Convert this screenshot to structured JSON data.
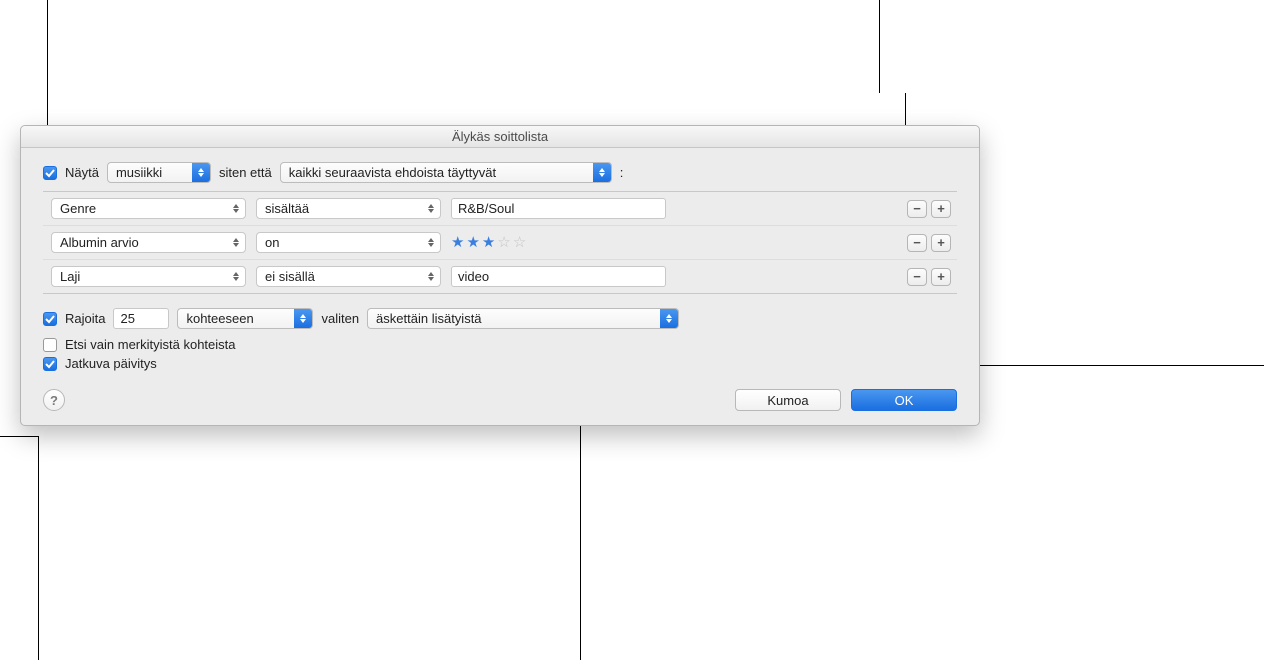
{
  "title": "Älykäs soittolista",
  "match": {
    "show_label": "Näytä",
    "media": "musiikki",
    "so_that": "siten että",
    "condition": "kaikki seuraavista ehdoista täyttyvät",
    "colon": ":"
  },
  "rules": [
    {
      "field": "Genre",
      "op": "sisältää",
      "value": "R&B/Soul",
      "type": "text"
    },
    {
      "field": "Albumin arvio",
      "op": "on",
      "stars": 3,
      "type": "stars"
    },
    {
      "field": "Laji",
      "op": "ei sisällä",
      "value": "video",
      "type": "text"
    }
  ],
  "limit": {
    "label": "Rajoita",
    "count": "25",
    "items_label": "kohteeseen",
    "selecting_label": "valiten",
    "by": "äskettäin lisätyistä"
  },
  "checked_only": {
    "label": "Etsi vain merkityistä kohteista",
    "checked": false
  },
  "live": {
    "label": "Jatkuva päivitys",
    "checked": true
  },
  "buttons": {
    "help": "?",
    "cancel": "Kumoa",
    "ok": "OK"
  },
  "icons": {
    "minus": "−",
    "plus": "+"
  }
}
